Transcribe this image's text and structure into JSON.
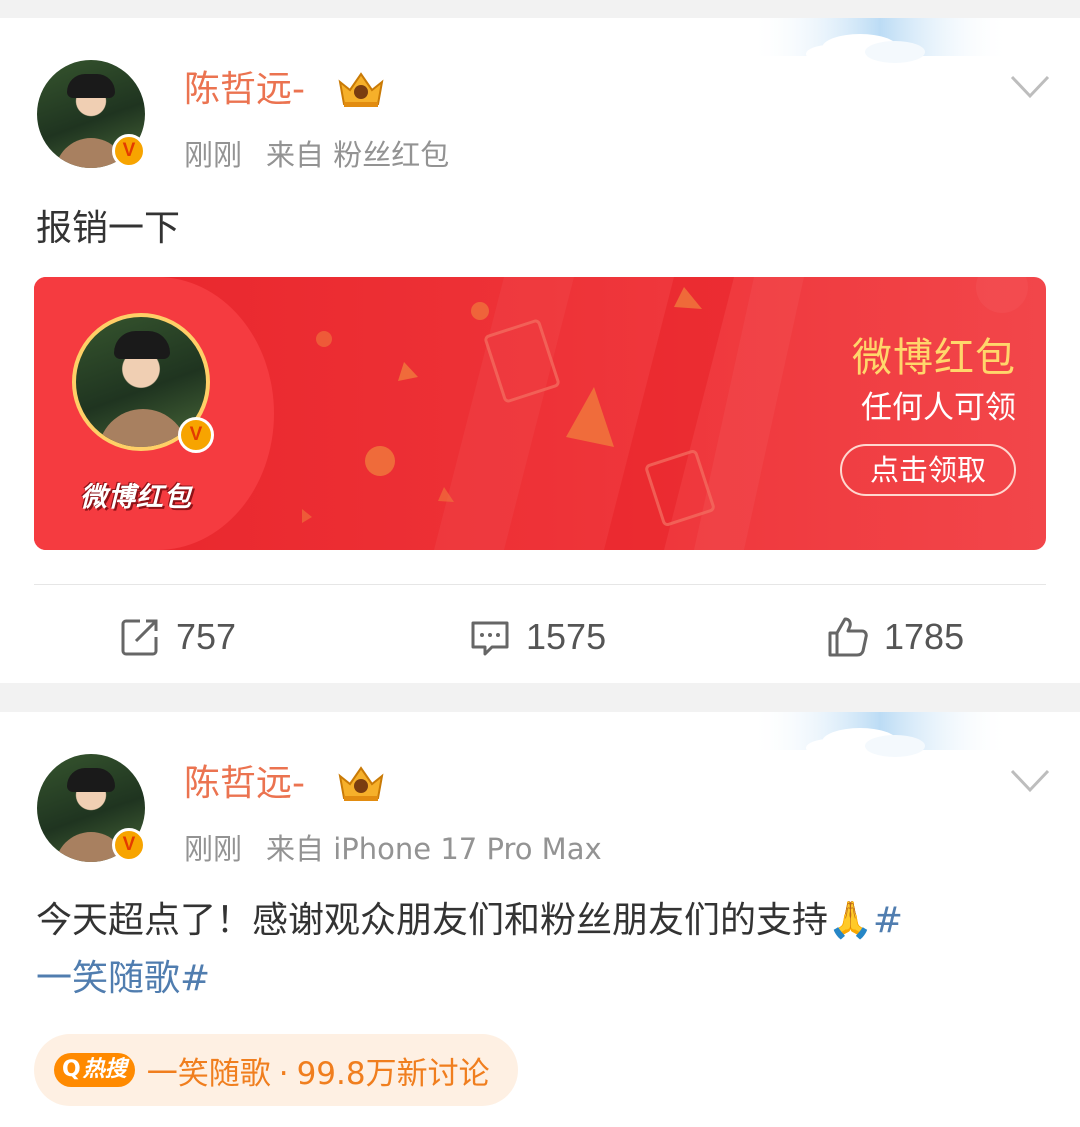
{
  "colors": {
    "name": "#eb7350",
    "meta": "#939393",
    "topic": "#507daf",
    "packet_red": "#ee3237",
    "packet_gold": "#ffd66b",
    "hot_orange": "#f07e1e"
  },
  "posts": [
    {
      "author": "陈哲远-",
      "time": "刚刚",
      "source": "来自 粉丝红包",
      "text": "报销一下",
      "red_packet": {
        "brand": "微博红包",
        "title": "微博红包",
        "subtitle": "任何人可领",
        "button": "点击领取"
      },
      "actions": {
        "repost_icon": "share-icon",
        "repost": "757",
        "comment_icon": "comment-icon",
        "comment": "1575",
        "like_icon": "thumbs-up-icon",
        "like": "1785"
      }
    },
    {
      "author": "陈哲远-",
      "time": "刚刚",
      "source": "来自 iPhone 17 Pro Max",
      "text_main": "今天超点了！感谢观众朋友们和粉丝朋友们的支持",
      "emoji": "🙏",
      "topic_tail": "#",
      "topic_line2": "一笑随歌#",
      "hot": {
        "tag": "热搜",
        "topic": "一笑随歌",
        "separator": "·",
        "stat": "99.8万新讨论"
      }
    }
  ]
}
